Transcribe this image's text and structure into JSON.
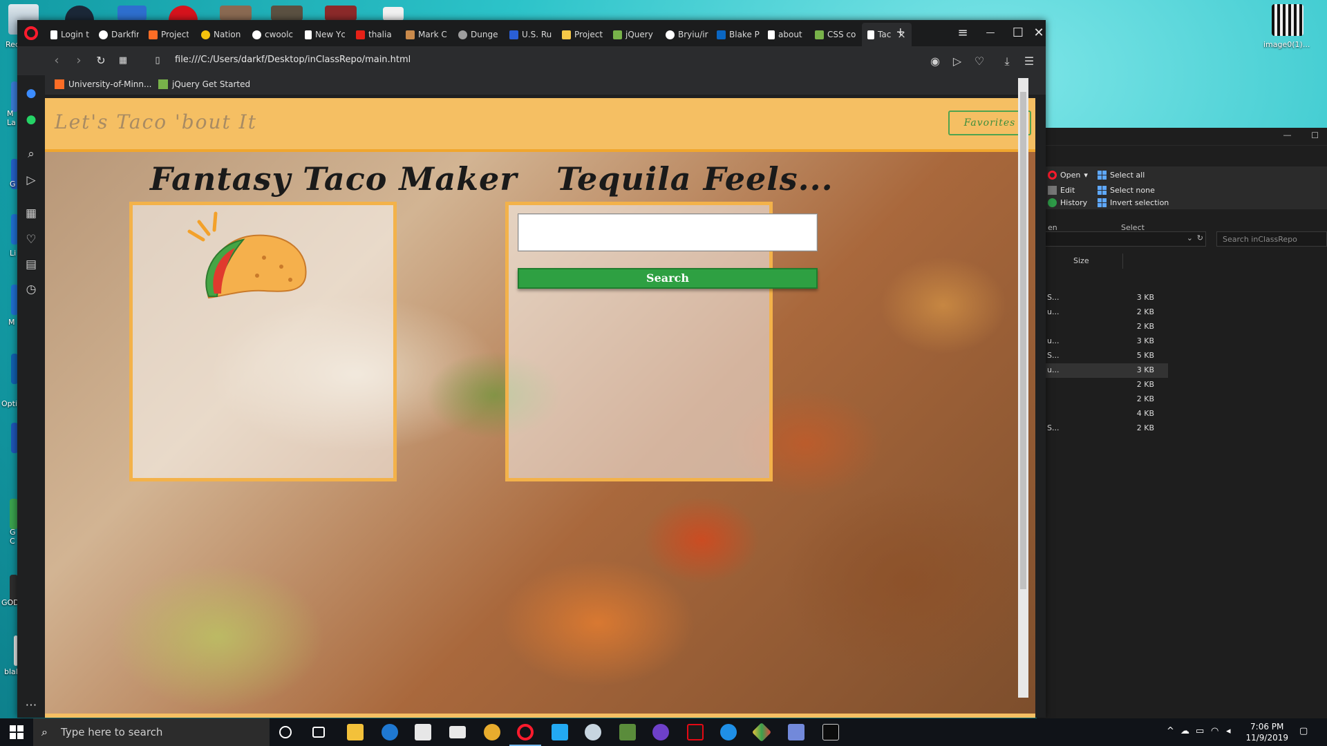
{
  "desktop": {
    "icons": [
      {
        "label": "Rec"
      },
      {
        "label": "M La"
      },
      {
        "label": "G"
      },
      {
        "label": "Li"
      },
      {
        "label": "M"
      },
      {
        "label": "Opti"
      },
      {
        "label": "G C"
      },
      {
        "label": "GOD"
      },
      {
        "label": "blal"
      }
    ],
    "top_right_icon_label": "image0(1)..."
  },
  "explorer": {
    "ribbon": {
      "open": "Open",
      "edit": "Edit",
      "history": "History",
      "open_group": "en",
      "select_all": "Select all",
      "select_none": "Select none",
      "invert_selection": "Invert selection",
      "select_group": "Select"
    },
    "search_placeholder": "Search inClassRepo",
    "size_header": "Size",
    "rows": [
      {
        "name": "S...",
        "size": "3 KB"
      },
      {
        "name": "u...",
        "size": "2 KB"
      },
      {
        "name": "",
        "size": "2 KB"
      },
      {
        "name": "u...",
        "size": "3 KB"
      },
      {
        "name": "S...",
        "size": "5 KB"
      },
      {
        "name": "u...",
        "size": "3 KB"
      },
      {
        "name": "",
        "size": "2 KB"
      },
      {
        "name": "",
        "size": "2 KB"
      },
      {
        "name": "",
        "size": "4 KB"
      },
      {
        "name": "S...",
        "size": "2 KB"
      }
    ]
  },
  "browser": {
    "tabs": [
      {
        "label": "Login t",
        "color": "#ffffff"
      },
      {
        "label": "Darkfir",
        "color": "#ffffff"
      },
      {
        "label": "Project",
        "color": "#fc6d26"
      },
      {
        "label": "Nation",
        "color": "#f4c20d"
      },
      {
        "label": "cwoolc",
        "color": "#ffffff"
      },
      {
        "label": "New Yc",
        "color": "#ffffff"
      },
      {
        "label": "thalia",
        "color": "#e62117"
      },
      {
        "label": "Mark C",
        "color": "#c98a4b"
      },
      {
        "label": "Dunge",
        "color": "#9e9e9e"
      },
      {
        "label": "U.S. Ru",
        "color": "#2a5fd6"
      },
      {
        "label": "Project",
        "color": "#f7c948"
      },
      {
        "label": "jQuery",
        "color": "#78b24a"
      },
      {
        "label": "Bryiu/ir",
        "color": "#ffffff"
      },
      {
        "label": "Blake P",
        "color": "#0a66c2"
      },
      {
        "label": "about",
        "color": "#ffffff"
      },
      {
        "label": "CSS co",
        "color": "#78b24a"
      }
    ],
    "active_tab": {
      "label": "Tac",
      "close": "×"
    },
    "new_tab": "+",
    "url": "file:///C:/Users/darkf/Desktop/inClassRepo/main.html",
    "bookmarks": [
      {
        "label": "University-of-Minn...",
        "color": "#fc6d26"
      },
      {
        "label": "jQuery Get Started",
        "color": "#78b24a"
      }
    ],
    "window_controls": {
      "minimize": "—",
      "maximize": "☐",
      "close": "✕",
      "menu": "≡"
    }
  },
  "page": {
    "brand": "Let's Taco 'bout It",
    "favorites_button": "Favorites",
    "left_title": "Fantasy Taco Maker",
    "right_title": "Tequila Feels...",
    "search_value": "",
    "search_button": "Search"
  },
  "taskbar": {
    "search_placeholder": "Type here to search",
    "time": "7:06 PM",
    "date": "11/9/2019"
  }
}
